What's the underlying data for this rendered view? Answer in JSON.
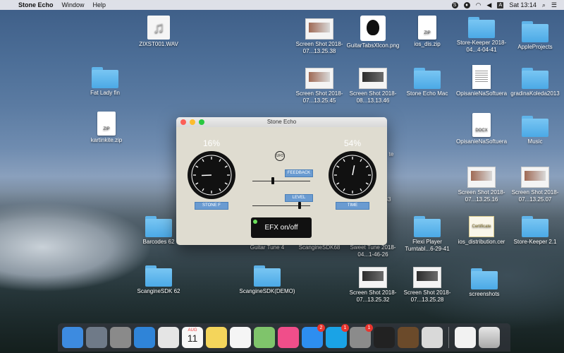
{
  "menubar": {
    "app_name": "Stone Echo",
    "items": [
      "Window",
      "Help"
    ],
    "status": {
      "time": "Sat 13:14",
      "keyboard": "A"
    }
  },
  "desktop_icons": [
    {
      "label": "ZIXST001.WAV",
      "kind": "music"
    },
    {
      "label": "Fat Lady fin",
      "kind": "folder"
    },
    {
      "label": "kartinkite.zip",
      "kind": "zip"
    },
    {
      "label": "Screen Shot 2018-07...13.25.38",
      "kind": "shot"
    },
    {
      "label": "GuitarTabsXIcon.png",
      "kind": "guitar"
    },
    {
      "label": "ios_dis.zip",
      "kind": "zip"
    },
    {
      "label": "Store-Keeper 2018-04...4-04-41",
      "kind": "folder"
    },
    {
      "label": "AppleProjects",
      "kind": "folder"
    },
    {
      "label": "Screen Shot 2018-07...13.25.45",
      "kind": "shot"
    },
    {
      "label": "Screen Shot 2018-08...13.13.46",
      "kind": "shotdark"
    },
    {
      "label": "Stone Echo Mac",
      "kind": "folder"
    },
    {
      "label": "OpisanieNaSoftuera",
      "kind": "doc"
    },
    {
      "label": "gradinaKoleda2013",
      "kind": "folder"
    },
    {
      "label": "OpisanieNaSoftuera",
      "kind": "docx"
    },
    {
      "label": "Music",
      "kind": "folder"
    },
    {
      "label": "Screen Shot 2018-07...13.25.16",
      "kind": "shot"
    },
    {
      "label": "Screen Shot 2018-07...13.25.07",
      "kind": "shot"
    },
    {
      "label": "Barcodes 62",
      "kind": "folder"
    },
    {
      "label": "Flexi Player Turntabl...6-29-41",
      "kind": "folder"
    },
    {
      "label": "ios_distribution.cer",
      "kind": "cert"
    },
    {
      "label": "Store-Keeper 2.1",
      "kind": "folder"
    },
    {
      "label": "ScangineSDK 62",
      "kind": "folder"
    },
    {
      "label": "ScangineSDK(DEMO)",
      "kind": "folder"
    },
    {
      "label": "Screen Shot 2018-07...13.25.32",
      "kind": "shotdark"
    },
    {
      "label": "Screen Shot 2018-07...13.25.28",
      "kind": "shotdark"
    },
    {
      "label": "screenshots",
      "kind": "folder"
    }
  ],
  "behind_labels": [
    "Guitar Tune 4",
    "ScangineSDK68",
    "Sweet Tune 2018-04...1-46-26",
    "EX 7-33",
    "te"
  ],
  "window": {
    "title": "Stone Echo",
    "left_percent": "16%",
    "right_percent": "54%",
    "left_value": 0.16,
    "right_value": 0.54,
    "left_knob_label": "STONE F",
    "right_knob_label": "TIME",
    "feedback_label": "FEEDBACK",
    "level_label": "LEVEL",
    "feedback_value": 0.35,
    "level_value": 0.82,
    "ufo": "UFO",
    "efx_button": "EFX on/off"
  },
  "dock": {
    "apps": [
      {
        "name": "finder-icon",
        "color": "#3d8be0"
      },
      {
        "name": "launchpad-icon",
        "color": "#6f7a88"
      },
      {
        "name": "calculator-icon",
        "color": "#8a8a8a"
      },
      {
        "name": "xcode-icon",
        "color": "#2f84d8"
      },
      {
        "name": "chrome-icon",
        "color": "#e5e5e5"
      },
      {
        "name": "calendar-icon",
        "color": "#f7f7f7"
      },
      {
        "name": "notes-icon",
        "color": "#f4d55b"
      },
      {
        "name": "reminders-icon",
        "color": "#f5f5f5"
      },
      {
        "name": "maps-icon",
        "color": "#7fc46b"
      },
      {
        "name": "itunes-icon",
        "color": "#f04e8a"
      },
      {
        "name": "appstore-icon",
        "color": "#2d8ef0",
        "badge": "2"
      },
      {
        "name": "skype-icon",
        "color": "#1aa3e6",
        "badge": "1"
      },
      {
        "name": "system-preferences-icon",
        "color": "#8b8b8b",
        "badge": "1"
      },
      {
        "name": "terminal-icon",
        "color": "#222222"
      },
      {
        "name": "guitar-app-icon",
        "color": "#6b4a2a"
      },
      {
        "name": "stone-echo-icon",
        "color": "#d9d9d9"
      }
    ],
    "calendar": {
      "month": "AUG",
      "day": "11"
    },
    "trash": "trash-icon",
    "doc": "music-file-icon"
  }
}
